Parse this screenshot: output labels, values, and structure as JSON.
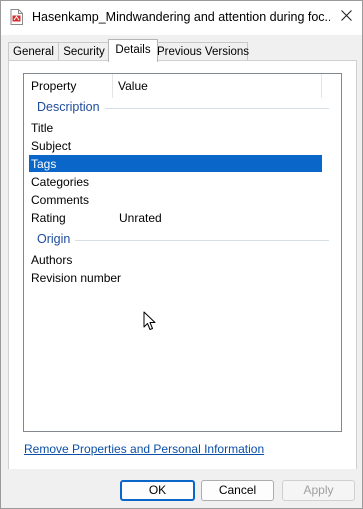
{
  "window": {
    "title": "Hasenkamp_Mindwandering and attention during foc...",
    "file_icon": "pdf-file-icon",
    "close_icon": "close-icon"
  },
  "tabs": [
    {
      "label": "General",
      "active": false
    },
    {
      "label": "Security",
      "active": false
    },
    {
      "label": "Details",
      "active": true
    },
    {
      "label": "Previous Versions",
      "active": false
    }
  ],
  "details": {
    "columns": {
      "property": "Property",
      "value": "Value"
    },
    "groups": [
      {
        "label": "Description",
        "rows": [
          {
            "name": "Title",
            "value": ""
          },
          {
            "name": "Subject",
            "value": ""
          },
          {
            "name": "Tags",
            "value": "",
            "selected": true
          },
          {
            "name": "Categories",
            "value": ""
          },
          {
            "name": "Comments",
            "value": ""
          },
          {
            "name": "Rating",
            "value": "Unrated"
          }
        ]
      },
      {
        "label": "Origin",
        "rows": [
          {
            "name": "Authors",
            "value": ""
          },
          {
            "name": "Revision number",
            "value": ""
          }
        ]
      }
    ]
  },
  "remove_link": "Remove Properties and Personal Information",
  "buttons": {
    "ok": "OK",
    "cancel": "Cancel",
    "apply": "Apply"
  },
  "colors": {
    "selection": "#0a66c8",
    "group_header": "#1e4c9c",
    "link": "#0b4fa8",
    "pdf_icon": "#d32f2f"
  }
}
